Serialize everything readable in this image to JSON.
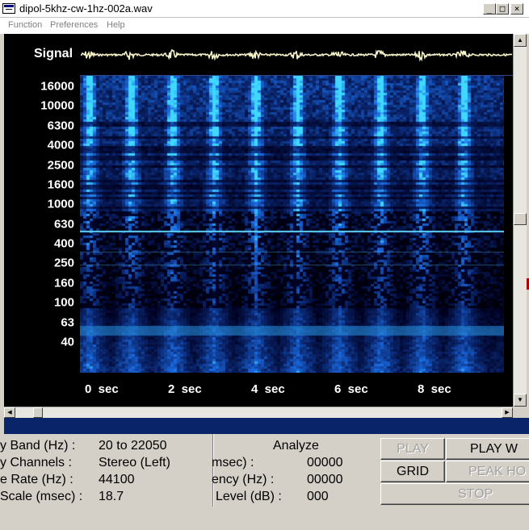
{
  "window": {
    "title": "dipol-5khz-cw-1hz-002a.wav",
    "minimize": "_",
    "maximize": "□",
    "close": "×"
  },
  "menu": {
    "function": "Function",
    "preferences": "Preferences",
    "help": "Help"
  },
  "display": {
    "signal_label": "Signal",
    "frequency_labels": [
      "16000",
      "10000",
      "6300",
      "4000",
      "2500",
      "1600",
      "1000",
      "630",
      "400",
      "250",
      "160",
      "100",
      "63",
      "40"
    ],
    "time_labels": [
      "0  sec",
      "2  sec",
      "4  sec",
      "6  sec",
      "8  sec"
    ],
    "time_values": [
      0,
      2,
      4,
      6,
      8
    ],
    "time_range": [
      0,
      10
    ],
    "pulse_times_sec": [
      0.2,
      1.2,
      2.2,
      3.2,
      4.2,
      5.2,
      6.2,
      7.2,
      8.2,
      9.2
    ],
    "colors": {
      "background": "#000000",
      "signal": "#f4f2c8",
      "spectrum_low": "#0a246a",
      "spectrum_mid": "#1a6ae0",
      "spectrum_high": "#40d8ff",
      "tone_line": "#60d8ff"
    }
  },
  "info": {
    "labels": {
      "band": "y Band (Hz) :",
      "channels": "y Channels :",
      "rate": "e Rate (Hz) :",
      "scale": "Scale (msec) :"
    },
    "values": {
      "band": "20 to 22050",
      "channels": "Stereo (Left)",
      "rate": "44100",
      "scale": "18.7"
    },
    "analyze": {
      "title": "Analyze",
      "time_label": "msec) :",
      "time_value": "00000",
      "freq_label": "ency (Hz) :",
      "freq_value": "00000",
      "level_label": "Level (dB) :",
      "level_value": "000"
    }
  },
  "buttons": {
    "play": "PLAY",
    "play_w": "PLAY W",
    "grid": "GRID",
    "peak": "PEAK HO",
    "stop": "STOP"
  }
}
